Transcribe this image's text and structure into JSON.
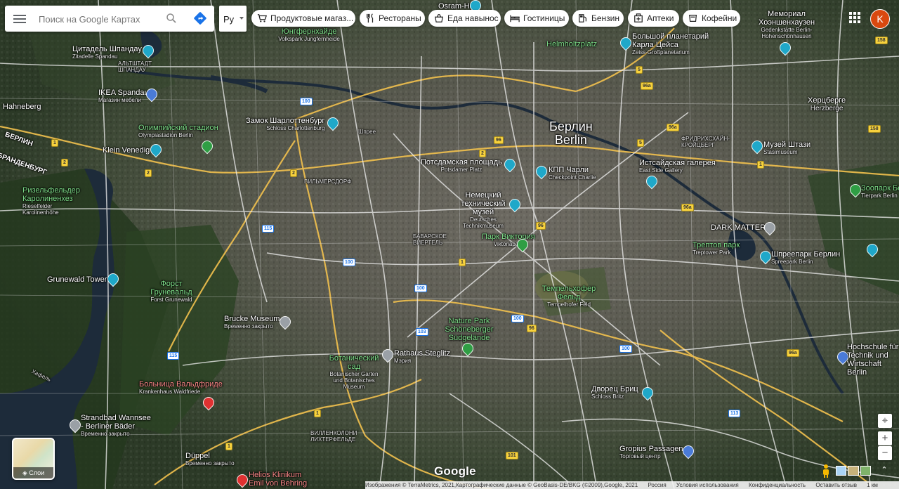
{
  "search": {
    "placeholder": "Поиск на Google Картах"
  },
  "language": {
    "value": "Ру"
  },
  "chips": [
    {
      "label": "Продуктовые магаз...",
      "icon": "cart-icon"
    },
    {
      "label": "Рестораны",
      "icon": "fork-knife-icon"
    },
    {
      "label": "Еда навынос",
      "icon": "takeout-icon"
    },
    {
      "label": "Гостиницы",
      "icon": "bed-icon"
    },
    {
      "label": "Бензин",
      "icon": "fuel-icon"
    },
    {
      "label": "Аптеки",
      "icon": "pharmacy-icon"
    },
    {
      "label": "Кофейни",
      "icon": "coffee-icon"
    }
  ],
  "account": {
    "initial": "K"
  },
  "layers": {
    "label": "Слои"
  },
  "brand": {
    "logo": "Google"
  },
  "attribution": {
    "imagery": "Изображения © TerraMetrics, 2021,Картографические данные © GeoBasis-DE/BKG (©2009),Google, 2021",
    "country": "Россия",
    "terms": "Условия использования",
    "privacy": "Конфиденциальность",
    "feedback": "Оставить отзыв",
    "scale": "1 км"
  },
  "colors": {
    "chip_bg": "#ffffff",
    "avatar": "#d9480f",
    "road_major": "#f2c14e",
    "road_minor": "#e6e6e6",
    "water": "#1d2b3a"
  },
  "places": {
    "city_ru": "Берлин",
    "city_de": "Berlin",
    "osram": "Osram-Hofe",
    "memorial": {
      "ru": "Мемориал Хоэншенхаузен",
      "de": "Gedenkstätte Berlin-Hohenschönhausen"
    },
    "volkspark": {
      "ru": "Фольксларк Юнгфернхайде",
      "de": "Volkspark Jungfernheide"
    },
    "citadel": {
      "ru": "Цитадель Шпандау",
      "de": "Zitadelle Spandau"
    },
    "altstadt": "АЛЬТШТАДТ ШПАНДАУ",
    "ikea": {
      "name": "IKEA Spandau",
      "sub": "Магазин мебели"
    },
    "hahneberg": "Hahneberg",
    "helmholtzplatz": "Helmholtzplatz",
    "planetarium": {
      "ru": "Большой планетарий Карла Цейса",
      "de": "Zeiss-Großplanetarium"
    },
    "hershausen": {
      "ru": "Херцберге",
      "de": "Herzberge"
    },
    "olympic": {
      "ru": "Олимпийский стадион",
      "de": "Olympiastadion Berlin"
    },
    "charlottenburg": {
      "ru": "Замок Шарлоттенбург",
      "de": "Schloss Charlottenburg"
    },
    "shpree": "Шпрее",
    "kleinvenedig": "Klein Venedig",
    "berlin_west": "БЕРЛИН",
    "brandenburg": "БРАНДЕНБУРГ",
    "stasi": {
      "ru": "Музей Штази",
      "de": "Stasimuseum"
    },
    "friedrichshain": "ФРИДРИХСХАЙН-КРОЙЦБЕРГ",
    "potsdamer": {
      "ru": "Потсдамская площадь",
      "de": "Potsdamer Platz"
    },
    "checkpoint": {
      "ru": "КПП Чарли",
      "de": "Checkpoint Charlie"
    },
    "eastside": {
      "ru": "Истсайдская галерея",
      "de": "East Side Gallery"
    },
    "wilmersdorf": "ВИЛЬМЕРСДОРФ",
    "rieselfelder": {
      "ru": "Ризельфельдер Каролиненхез",
      "de": "Rieselfelder Karolinenhöhe"
    },
    "technik": {
      "ru": "Немецкий технический музей",
      "de": "Deutsches Technikmuseum"
    },
    "tierpark": {
      "ru": "Зоопарк Берлин",
      "de": "Tierpark Berlin"
    },
    "darkmatter": "DARK MATTER",
    "viktoriapark": {
      "ru": "Парк Виктория",
      "de": "Viktoriapark"
    },
    "bayerisches": "БАВАРСКОЕ ВИЕРТЕЛЬ",
    "treptower": {
      "ru": "Трептов парк",
      "de": "Treptower Park"
    },
    "spreepark": {
      "ru": "Шпрeепарк Берлин",
      "de": "Spreepark Berlin"
    },
    "grunewaldtower": "Grunewald Tower",
    "forest": {
      "ru": "Форст Груневальд",
      "de": "Forst Grunewald"
    },
    "tempelhof": {
      "ru": "Темпельхофер Фельд",
      "de": "Tempelhofer Feld"
    },
    "brucke": {
      "name": "Brucke Museum",
      "sub": "Временно закрыто"
    },
    "naturepark": {
      "name": "Nature Park Schöneberger Südgelände"
    },
    "botanical": {
      "ru": "Ботанический сад",
      "de": "Botanischer Garten und Botanisches Museum"
    },
    "rathaus": {
      "name": "Rathaus Steglitz",
      "sub": "Мэрия"
    },
    "havel": "Хафель",
    "waldfriede": {
      "ru": "Больница Вальдфриде",
      "de": "Krankenhaus Waldfriede"
    },
    "britz": {
      "ru": "Дворец Бриц",
      "de": "Schloss Britz"
    },
    "hochschule": "Hochschule für Technik und Wirtschaft Berlin",
    "strandbad": {
      "name": "Strandbad Wannsee - Berliner Bäder",
      "sub": "Временно закрыто"
    },
    "lichterfelde": "ВИЛЛЕНКОЛОНИ ЛИХТЕРФЕЛЬДЕ",
    "gropius": {
      "name": "Gropius Passagen",
      "sub": "Торговый центр"
    },
    "duppel": {
      "name": "Düppel",
      "sub": "Временно закрыто"
    },
    "helios": {
      "name": "Helios Klinikum Emil von Behring"
    }
  },
  "shields": [
    "1",
    "2",
    "2",
    "2",
    "2",
    "5",
    "5",
    "96",
    "96a",
    "96a",
    "96",
    "96",
    "96a",
    "100",
    "100",
    "100",
    "100",
    "100",
    "103",
    "113",
    "115",
    "115",
    "158",
    "158",
    "1",
    "1",
    "1",
    "1",
    "101",
    "96a"
  ]
}
